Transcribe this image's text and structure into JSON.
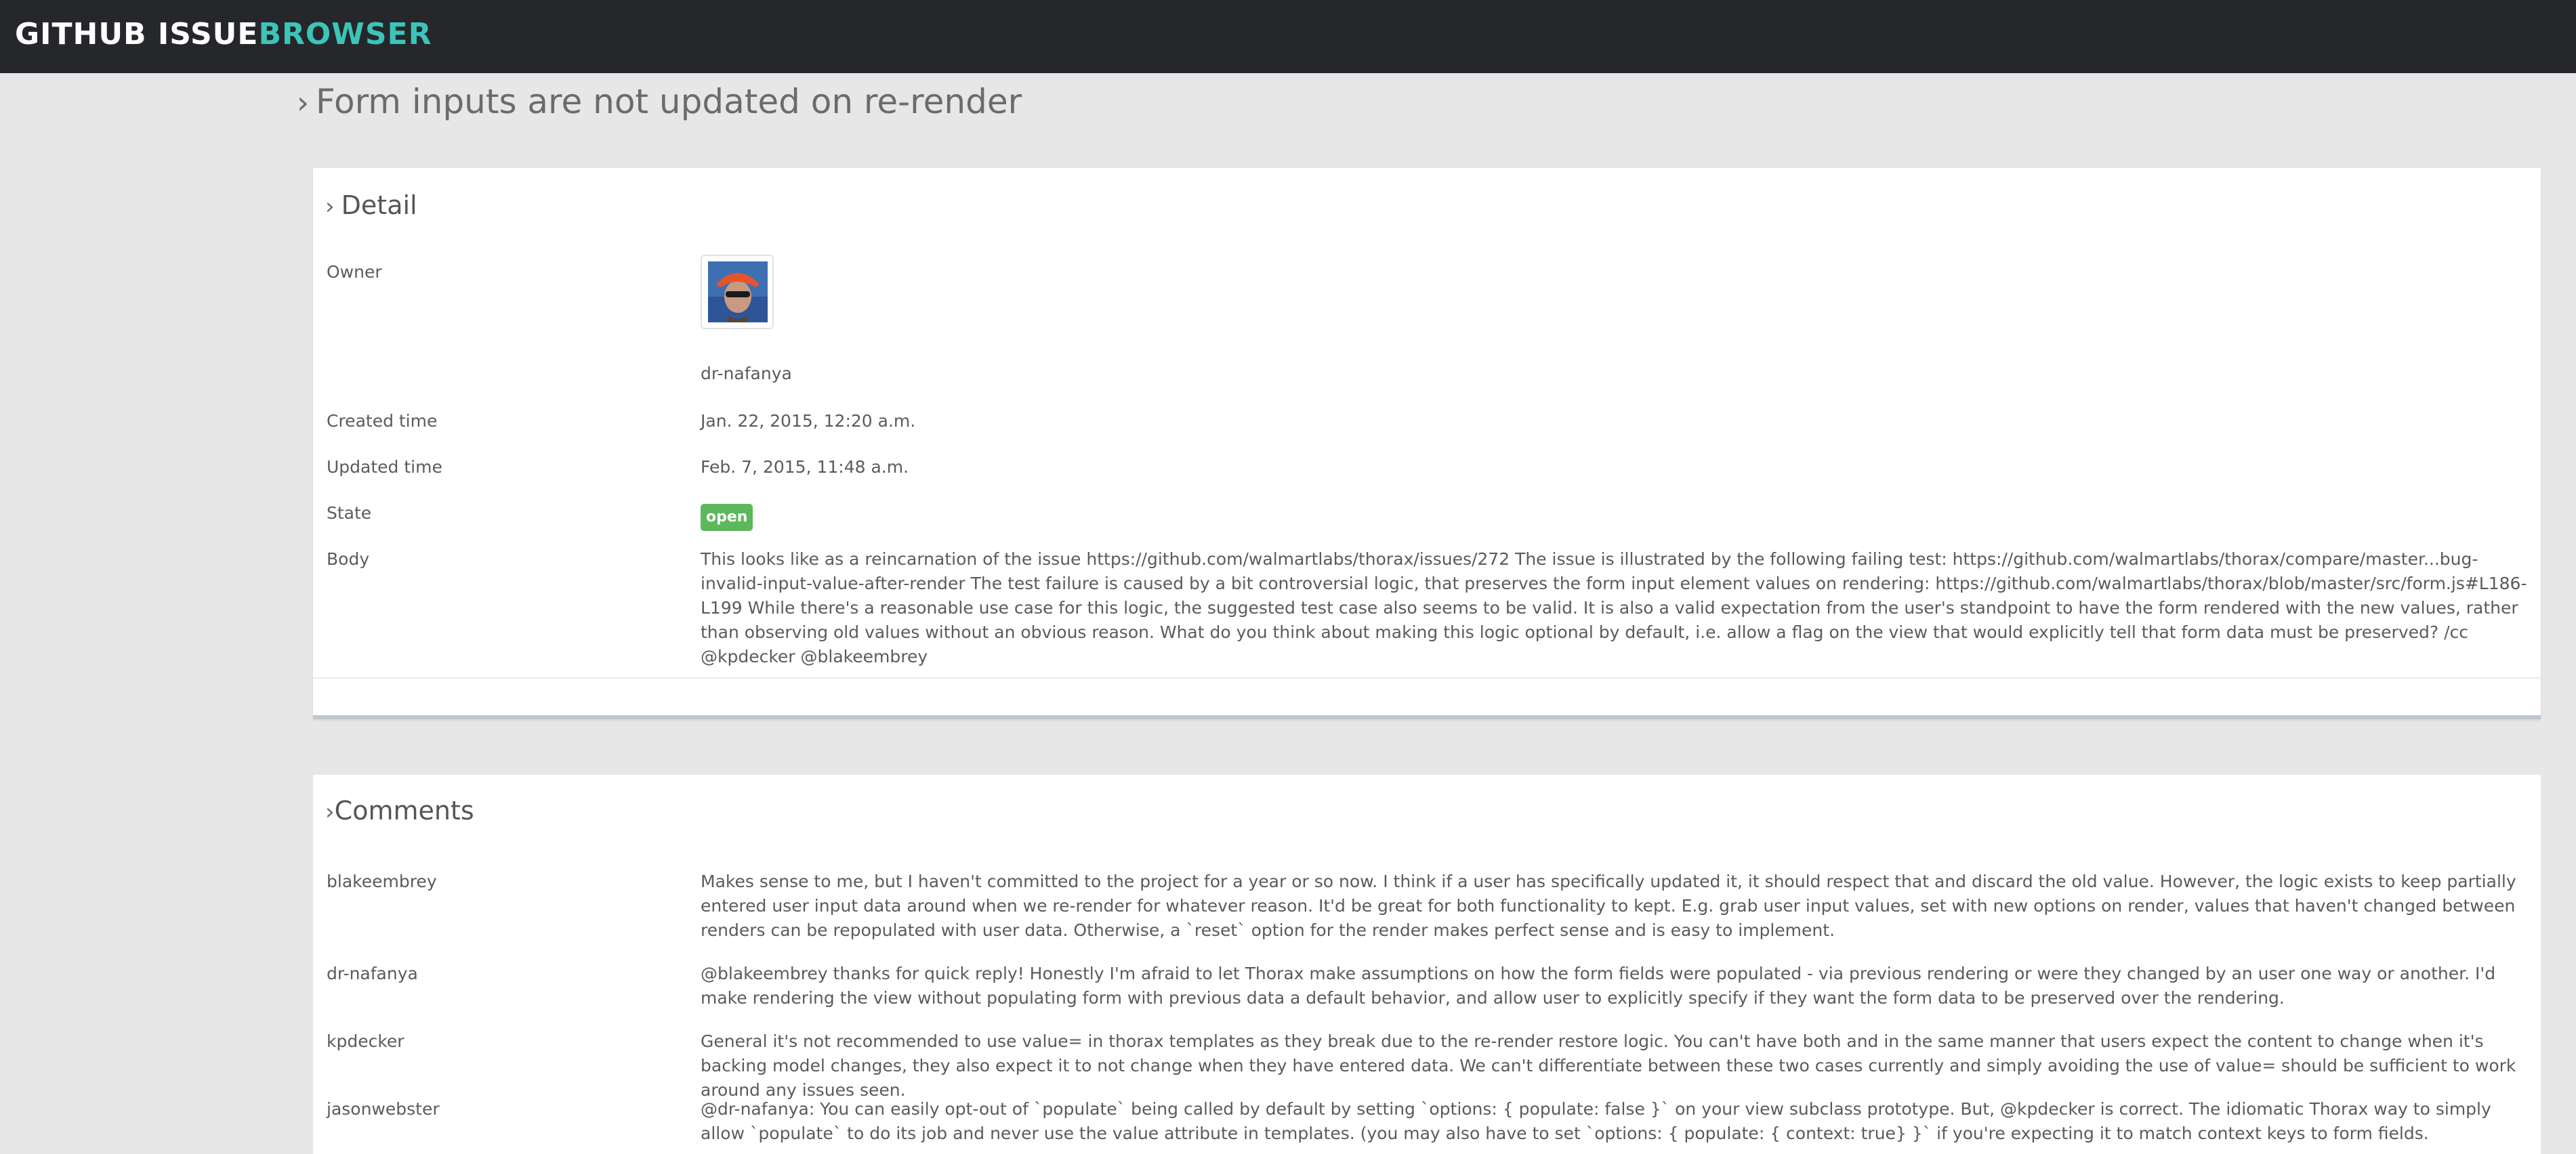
{
  "app": {
    "brand_main": "GITHUB ISSUE",
    "brand_accent": "BROWSER"
  },
  "issue": {
    "title": "Form inputs are not updated on re-render"
  },
  "detail": {
    "heading": "Detail",
    "owner_label": "Owner",
    "owner_name": "dr-nafanya",
    "created_label": "Created time",
    "created_value": "Jan. 22, 2015, 12:20 a.m.",
    "updated_label": "Updated time",
    "updated_value": "Feb. 7, 2015, 11:48 a.m.",
    "state_label": "State",
    "state_value": "open",
    "body_label": "Body",
    "body_value": "This looks like as a reincarnation of the issue https://github.com/walmartlabs/thorax/issues/272 The issue is illustrated by the following failing test: https://github.com/walmartlabs/thorax/compare/master...bug-invalid-input-value-after-render The test failure is caused by a bit controversial logic, that preserves the form input element values on rendering: https://github.com/walmartlabs/thorax/blob/master/src/form.js#L186-L199 While there's a reasonable use case for this logic, the suggested test case also seems to be valid. It is also a valid expectation from the user's standpoint to have the form rendered with the new values, rather than observing old values without an obvious reason. What do you think about making this logic optional by default, i.e. allow a flag on the view that would explicitly tell that form data must be preserved? /cc @kpdecker @blakeembrey"
  },
  "comments": {
    "heading": "Comments",
    "items": [
      {
        "author": "blakeembrey",
        "text": "Makes sense to me, but I haven't committed to the project for a year or so now. I think if a user has specifically updated it, it should respect that and discard the old value. However, the logic exists to keep partially entered user input data around when we re-render for whatever reason. It'd be great for both functionality to kept. E.g. grab user input values, set with new options on render, values that haven't changed between renders can be repopulated with user data. Otherwise, a `reset` option for the render makes perfect sense and is easy to implement."
      },
      {
        "author": "dr-nafanya",
        "text": "@blakeembrey thanks for quick reply! Honestly I'm afraid to let Thorax make assumptions on how the form fields were populated - via previous rendering or were they changed by an user one way or another. I'd make rendering the view without populating form with previous data a default behavior, and allow user to explicitly specify if they want the form data to be preserved over the rendering."
      },
      {
        "author": "kpdecker",
        "text": "General it's not recommended to use value= in thorax templates as they break due to the re-render restore logic. You can't have both and in the same manner that users expect the content to change when it's backing model changes, they also expect it to not change when they have entered data. We can't differentiate between these two cases currently and simply avoiding the use of value= should be sufficient to work around any issues seen."
      },
      {
        "author": "jasonwebster",
        "text": "@dr-nafanya: You can easily opt-out of `populate` being called by default by setting `options: { populate: false }` on your view subclass prototype. But, @kpdecker is correct. The idiomatic Thorax way to simply allow `populate` to do its job and never use the value attribute in templates. (you may also have to set `options: { populate: { context: true} }` if you're expecting it to match context keys to form fields."
      }
    ]
  },
  "colors": {
    "topbar": "#25272a",
    "brand_accent": "#3cc4b8",
    "state_open": "#5cb85c",
    "page_bg": "#e7e7e7"
  }
}
